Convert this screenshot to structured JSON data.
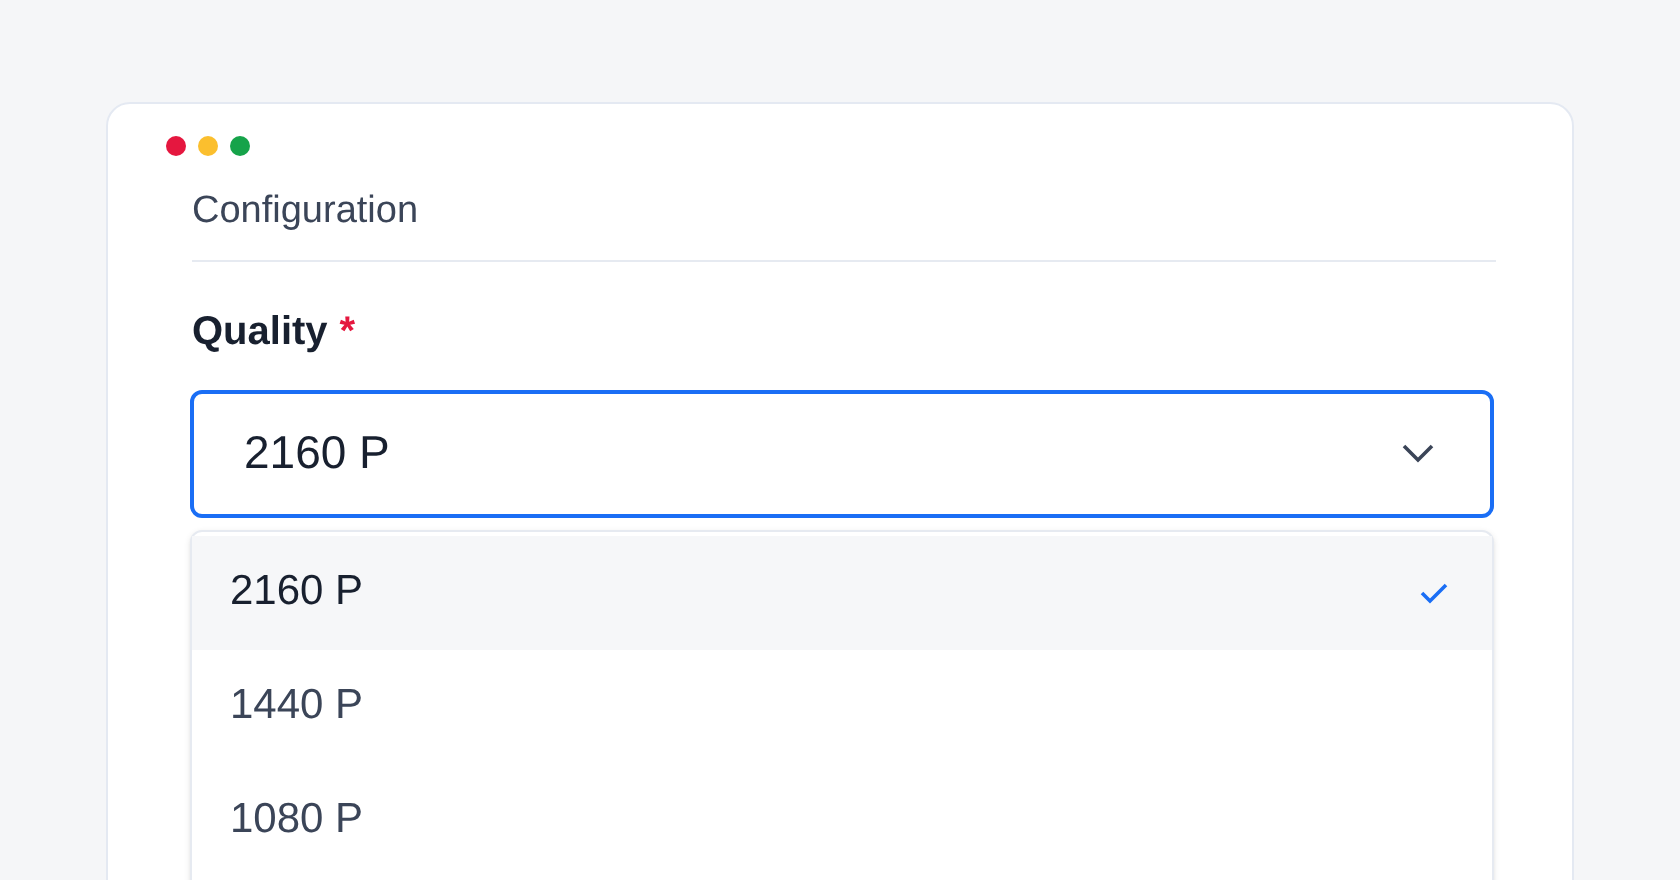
{
  "window": {
    "controls": [
      {
        "color": "#e5173f"
      },
      {
        "color": "#fbbf2e"
      },
      {
        "color": "#16a34a"
      }
    ]
  },
  "section": {
    "title": "Configuration"
  },
  "field": {
    "label": "Quality",
    "required_mark": "*",
    "value": "2160 P",
    "expanded": true,
    "options": [
      {
        "label": "2160 P",
        "selected": true
      },
      {
        "label": "1440 P",
        "selected": false
      },
      {
        "label": "1080 P",
        "selected": false
      }
    ]
  }
}
